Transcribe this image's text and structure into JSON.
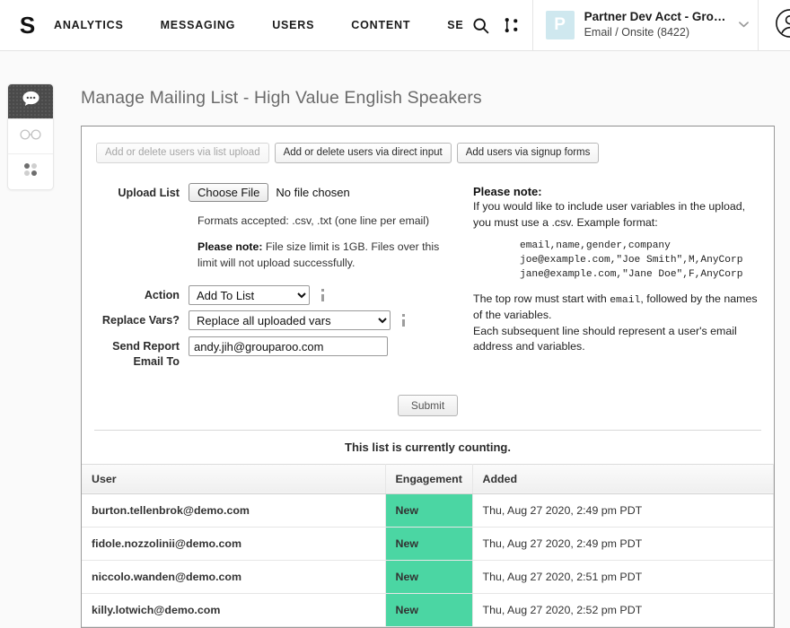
{
  "header": {
    "logo": "S",
    "nav": [
      {
        "label": "ANALYTICS",
        "name": "analytics"
      },
      {
        "label": "MESSAGING",
        "name": "messaging"
      },
      {
        "label": "USERS",
        "name": "users"
      },
      {
        "label": "CONTENT",
        "name": "content"
      },
      {
        "label": "SE",
        "name": "settings-clipped"
      }
    ],
    "icons": {
      "search": "search-icon",
      "share": "share-nodes-icon",
      "profile": "user-circle-icon"
    },
    "account": {
      "avatar_letter": "P",
      "avatar_color": "#cfe8ef",
      "title": "Partner Dev Acct - Grou…",
      "subtitle": "Email / Onsite (8422)",
      "caret": "chevron-down-icon"
    }
  },
  "rail": {
    "items": [
      {
        "name": "messages",
        "icon": "chat-bubble-icon",
        "active": true
      },
      {
        "name": "explore",
        "icon": "glasses-icon",
        "active": false
      },
      {
        "name": "apps",
        "icon": "four-dots-grid-icon",
        "active": false
      }
    ]
  },
  "main": {
    "page_title": "Manage Mailing List - High Value English Speakers",
    "tabs": [
      {
        "label": "Add or delete users via list upload",
        "disabled": true
      },
      {
        "label": "Add or delete users via direct input",
        "disabled": false
      },
      {
        "label": "Add users via signup forms",
        "disabled": false
      }
    ],
    "form": {
      "upload_label": "Upload List",
      "choose_file_label": "Choose File",
      "file_status": "No file chosen",
      "formats_note": "Formats accepted: .csv, .txt (one line per email)",
      "size_note_strong": "Please note:",
      "size_note": " File size limit is 1GB. Files over this limit will not upload successfully.",
      "action_label": "Action",
      "action_value": "Add To List",
      "action_options": [
        "Add To List"
      ],
      "replace_vars_label": "Replace Vars?",
      "replace_vars_value": "Replace all uploaded vars",
      "replace_vars_options": [
        "Replace all uploaded vars"
      ],
      "email_label": "Send Report Email To",
      "email_value": "andy.jih@grouparoo.com",
      "submit_label": "Submit"
    },
    "note": {
      "heading": "Please note:",
      "intro": "If you would like to include user variables in the upload, you must use a .csv. Example format:",
      "code": "email,name,gender,company\njoe@example.com,\"Joe Smith\",M,AnyCorp\njane@example.com,\"Jane Doe\",F,AnyCorp",
      "rule1_pre": "The top row must start with ",
      "rule1_code": "email",
      "rule1_post": ", followed by the names of the variables.",
      "rule2": "Each subsequent line should represent a user's email address and variables."
    },
    "status_text": "This list is currently counting.",
    "table": {
      "columns": [
        "User",
        "Engagement",
        "Added"
      ],
      "rows": [
        {
          "user": "burton.tellenbrok@demo.com",
          "engagement": "New",
          "added": "Thu, Aug 27 2020, 2:49 pm PDT"
        },
        {
          "user": "fidole.nozzolinii@demo.com",
          "engagement": "New",
          "added": "Thu, Aug 27 2020, 2:49 pm PDT"
        },
        {
          "user": "niccolo.wanden@demo.com",
          "engagement": "New",
          "added": "Thu, Aug 27 2020, 2:51 pm PDT"
        },
        {
          "user": "killy.lotwich@demo.com",
          "engagement": "New",
          "added": "Thu, Aug 27 2020, 2:52 pm PDT"
        }
      ],
      "badge_color": "#4bd6a3"
    }
  }
}
